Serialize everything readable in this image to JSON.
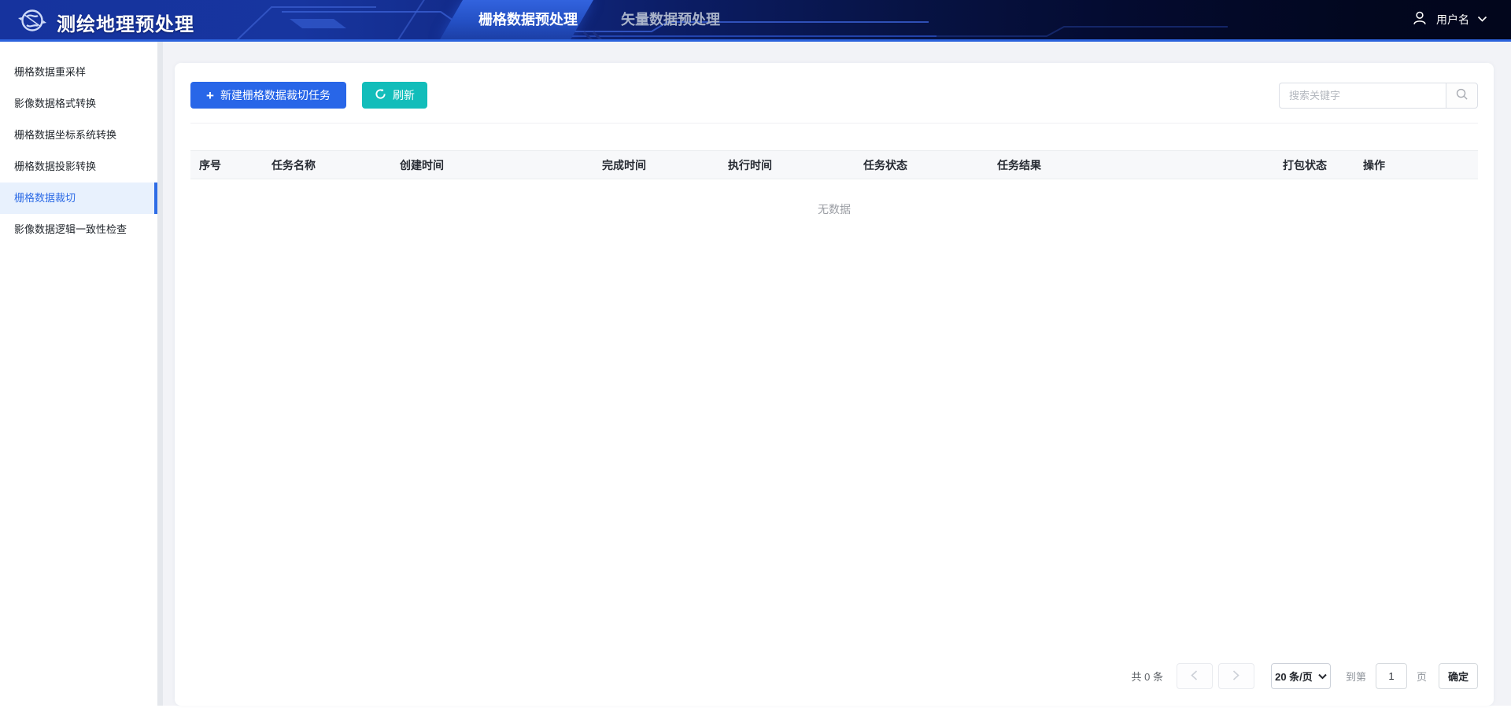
{
  "app": {
    "title": "测绘地理预处理"
  },
  "header": {
    "tabs": [
      {
        "label": "栅格数据预处理"
      },
      {
        "label": "矢量数据预处理"
      }
    ],
    "user": {
      "name": "用户名"
    }
  },
  "sidebar": {
    "items": [
      {
        "label": "栅格数据重采样"
      },
      {
        "label": "影像数据格式转换"
      },
      {
        "label": "栅格数据坐标系统转换"
      },
      {
        "label": "栅格数据投影转换"
      },
      {
        "label": "栅格数据裁切"
      },
      {
        "label": "影像数据逻辑一致性检查"
      }
    ]
  },
  "toolbar": {
    "new_task_label": "新建栅格数据裁切任务",
    "refresh_label": "刷新",
    "search_placeholder": "搜索关键字"
  },
  "table": {
    "columns": [
      "序号",
      "任务名称",
      "创建时间",
      "完成时间",
      "执行时间",
      "任务状态",
      "任务结果",
      "打包状态",
      "操作"
    ],
    "rows": [],
    "empty_text": "无数据"
  },
  "pagination": {
    "total_text": "共 0 条",
    "page_size_label": "20 条/页",
    "goto_prefix": "到第",
    "goto_value": "1",
    "goto_suffix": "页",
    "confirm_label": "确定"
  },
  "colors": {
    "accent_blue": "#2866e8",
    "accent_teal": "#12bdba",
    "header_left": "#16339e",
    "header_right": "#02061c",
    "header_border": "#2c63dd",
    "active_tab_gradient_top": "#3263de",
    "sidebar_active_bg": "#e8f1fd",
    "sidebar_active_text": "#2e6ce6",
    "table_header_bg": "#f7f8fa",
    "page_bg": "#f2f3f7"
  }
}
